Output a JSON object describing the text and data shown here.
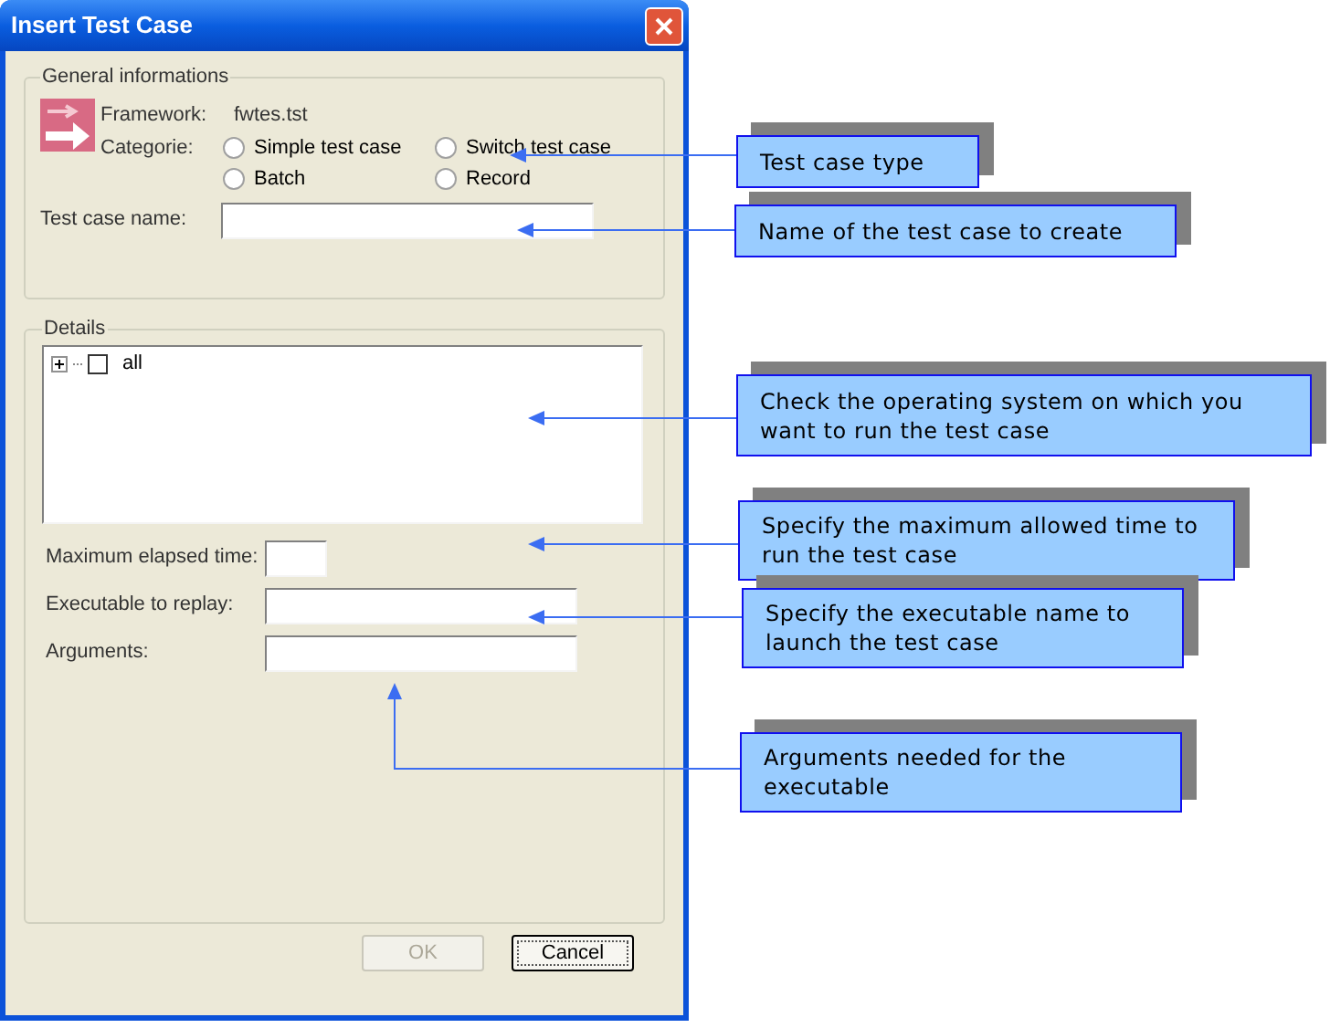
{
  "window": {
    "title": "Insert Test Case"
  },
  "general": {
    "title": "General informations",
    "framework_label": "Framework:",
    "framework_value": "fwtes.tst",
    "category_label": "Categorie:",
    "categories": [
      {
        "label": "Simple test case",
        "selected": false
      },
      {
        "label": "Switch test case",
        "selected": false
      },
      {
        "label": "Batch",
        "selected": false
      },
      {
        "label": "Record",
        "selected": false
      }
    ],
    "name_label": "Test case name:"
  },
  "details": {
    "title": "Details",
    "tree": [
      {
        "label": "all",
        "checked": false,
        "expanded": false
      }
    ],
    "fields": [
      {
        "label": "Maximum elapsed time:",
        "kind": "short"
      },
      {
        "label": "Executable to replay:",
        "kind": "long"
      },
      {
        "label": "Arguments:",
        "kind": "long"
      }
    ]
  },
  "buttons": [
    {
      "label": "OK",
      "disabled": true
    },
    {
      "label": "Cancel",
      "disabled": false
    }
  ],
  "annotations": [
    "Test case type",
    "Name of the test case to create",
    "Check the operating system on which you want to run the test case",
    "Specify the maximum allowed time to run the test case",
    "Specify the executable name to launch the test case",
    "Arguments needed for the executable"
  ]
}
